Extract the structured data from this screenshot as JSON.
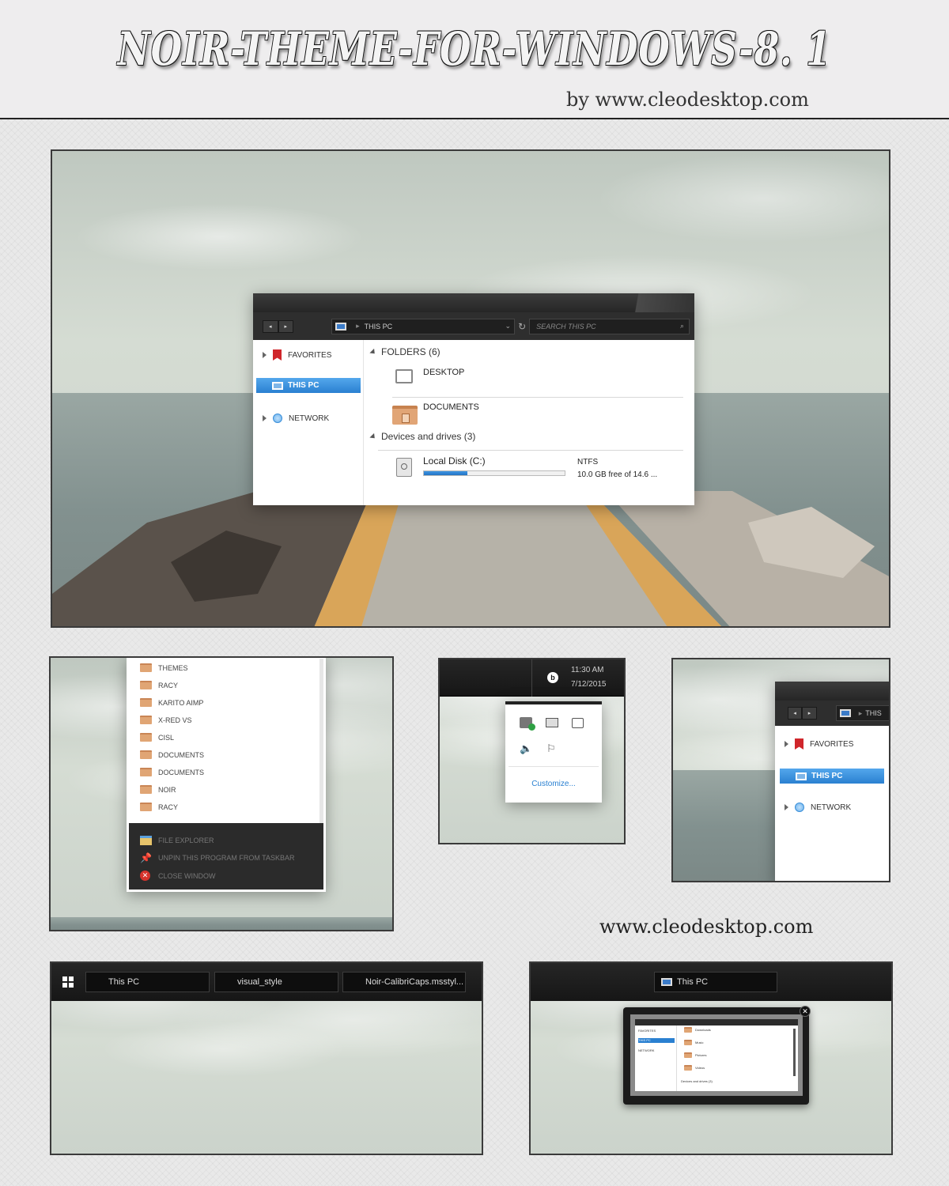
{
  "header": {
    "title": "NOIR-THEME-FOR-WINDOWS-8. 1",
    "byline": "by www.cleodesktop.com"
  },
  "explorer": {
    "address": "THIS PC",
    "search_placeholder": "SEARCH THIS PC",
    "sidebar": [
      "FAVORITES",
      "THIS PC",
      "NETWORK"
    ],
    "folders_group": "FOLDERS (6)",
    "folders": [
      "DESKTOP",
      "DOCUMENTS"
    ],
    "devices_group": "Devices and drives (3)",
    "drive": {
      "name": "Local Disk (C:)",
      "fs": "NTFS",
      "free": "10.0 GB free of 14.6 ...",
      "used_fraction": 0.31
    }
  },
  "jumplist": {
    "items": [
      "THEMES",
      "RACY",
      "KARITO AIMP",
      "X-RED VS",
      "CISL",
      "DOCUMENTS",
      "DOCUMENTS",
      "NOIR",
      "RACY"
    ],
    "tasks": [
      "FILE EXPLORER",
      "UNPIN THIS PROGRAM FROM TASKBAR",
      "CLOSE WINDOW"
    ]
  },
  "tray": {
    "time": "11:30 AM",
    "date": "7/12/2015",
    "customize": "Customize..."
  },
  "explorer_zoom": {
    "address_crumb": "THIS",
    "sidebar": [
      "FAVORITES",
      "THIS PC",
      "NETWORK"
    ]
  },
  "watermark": "www.cleodesktop.com",
  "taskbar1": {
    "buttons": [
      "This PC",
      "visual_style",
      "Noir-CalibriCaps.msstyl..."
    ]
  },
  "taskbar2": {
    "button": "This PC",
    "thumb": {
      "sidebar": [
        "FAVORITES",
        "THIS PC",
        "NETWORK"
      ],
      "items": [
        "Downloads",
        "Music",
        "Pictures",
        "Videos"
      ],
      "group": "Devices and drives (3)"
    }
  },
  "colors": {
    "accent": "#2a80d1",
    "dark": "#262626",
    "folder": "#e0a574",
    "favorite": "#d0262b"
  }
}
